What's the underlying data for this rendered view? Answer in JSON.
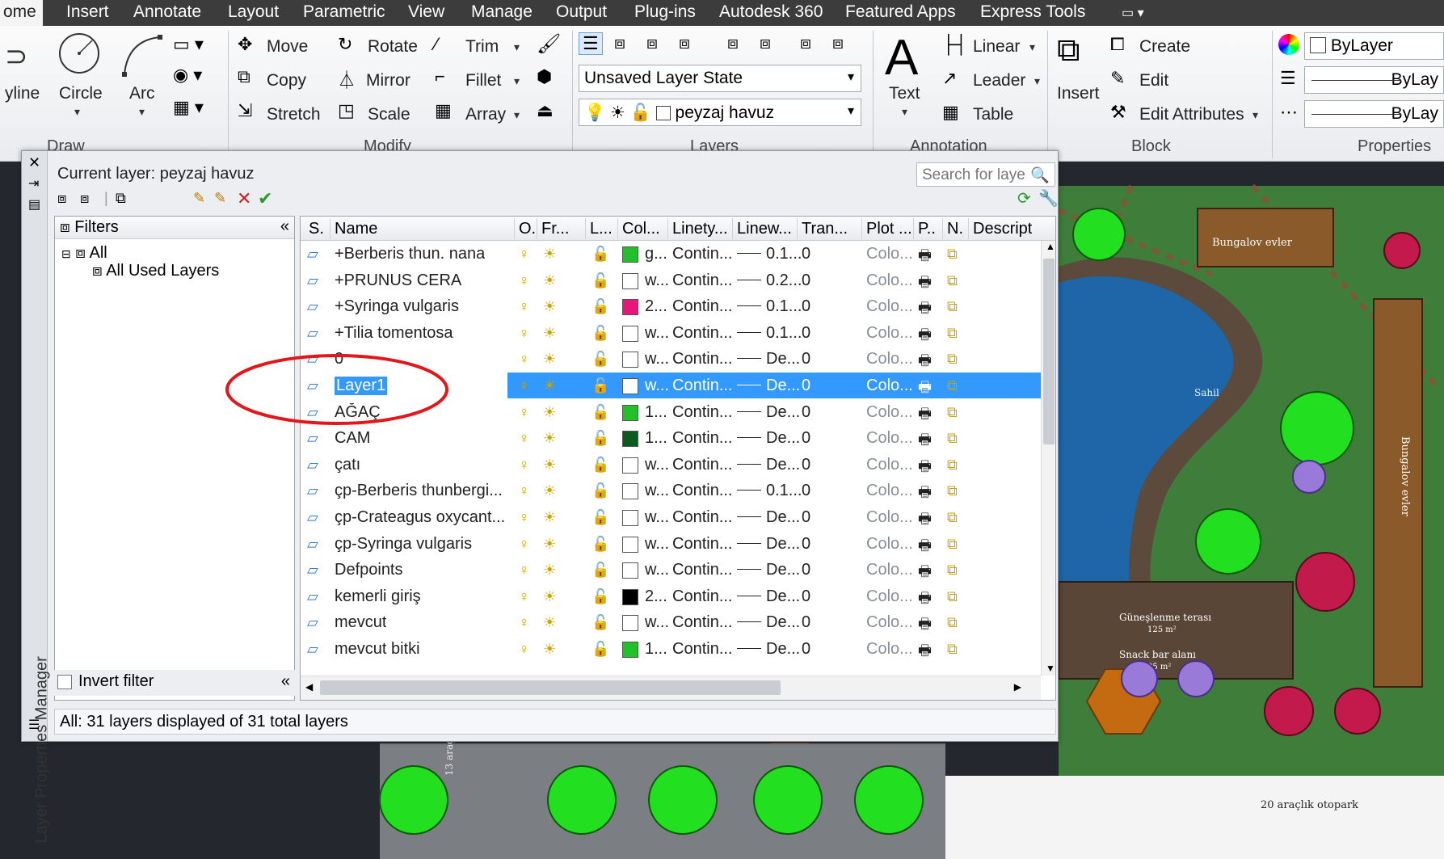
{
  "menu": [
    "ome",
    "Insert",
    "Annotate",
    "Layout",
    "Parametric",
    "View",
    "Manage",
    "Output",
    "Plug-ins",
    "Autodesk 360",
    "Featured Apps",
    "Express Tools"
  ],
  "ribbon": {
    "draw": {
      "title": "Draw",
      "polyline": "yline",
      "circle": "Circle",
      "arc": "Arc"
    },
    "modify": {
      "title": "Modify",
      "move": "Move",
      "rotate": "Rotate",
      "trim": "Trim",
      "copy": "Copy",
      "mirror": "Mirror",
      "fillet": "Fillet",
      "stretch": "Stretch",
      "scale": "Scale",
      "array": "Array"
    },
    "layers": {
      "title": "Layers",
      "state": "Unsaved Layer State",
      "current": "peyzaj havuz"
    },
    "annotation": {
      "title": "Annotation",
      "text": "Text",
      "linear": "Linear",
      "leader": "Leader",
      "table": "Table"
    },
    "block": {
      "title": "Block",
      "insert": "Insert",
      "create": "Create",
      "edit": "Edit",
      "edit_attributes": "Edit Attributes"
    },
    "properties": {
      "title": "Properties",
      "color": "ByLayer",
      "linetype": "ByLay",
      "lineweight": "ByLay"
    }
  },
  "palette": {
    "side_title": "Layer Properties Manager",
    "current_layer": "Current layer: peyzaj havuz",
    "search_placeholder": "Search for laye",
    "filters_label": "Filters",
    "tree_all": "All",
    "tree_used": "All Used Layers",
    "invert_filter": "Invert filter",
    "status": "All: 31 layers displayed of 31 total layers",
    "columns": [
      "S.",
      "Name",
      "O.",
      "Fr...",
      "L...",
      "Col...",
      "Linety...",
      "Linew...",
      "Tran...",
      "Plot ...",
      "P..",
      "N.",
      "Descript"
    ],
    "rows": [
      {
        "name": "+Berberis thun. nana",
        "color": "#22c02a",
        "color_name": "g...",
        "linetype": "Contin...",
        "lineweight": "0.1...",
        "transparency": "0",
        "plot_style": "Colo...",
        "selected": false
      },
      {
        "name": "+PRUNUS CERA",
        "color": "#ffffff",
        "color_name": "w...",
        "linetype": "Contin...",
        "lineweight": "0.2...",
        "transparency": "0",
        "plot_style": "Colo...",
        "selected": false
      },
      {
        "name": "+Syringa vulgaris",
        "color": "#e8157a",
        "color_name": "2...",
        "linetype": "Contin...",
        "lineweight": "0.1...",
        "transparency": "0",
        "plot_style": "Colo...",
        "selected": false
      },
      {
        "name": "+Tilia tomentosa",
        "color": "#ffffff",
        "color_name": "w...",
        "linetype": "Contin...",
        "lineweight": "0.1...",
        "transparency": "0",
        "plot_style": "Colo...",
        "selected": false
      },
      {
        "name": "0",
        "color": "#ffffff",
        "color_name": "w...",
        "linetype": "Contin...",
        "lineweight": "De...",
        "transparency": "0",
        "plot_style": "Colo...",
        "selected": false
      },
      {
        "name": "Layer1",
        "color": "#ffffff",
        "color_name": "w...",
        "linetype": "Contin...",
        "lineweight": "De...",
        "transparency": "0",
        "plot_style": "Colo...",
        "selected": true
      },
      {
        "name": "AĞAÇ",
        "color": "#22c02a",
        "color_name": "1...",
        "linetype": "Contin...",
        "lineweight": "De...",
        "transparency": "0",
        "plot_style": "Colo...",
        "selected": false
      },
      {
        "name": "CAM",
        "color": "#0b5a1e",
        "color_name": "1...",
        "linetype": "Contin...",
        "lineweight": "De...",
        "transparency": "0",
        "plot_style": "Colo...",
        "selected": false
      },
      {
        "name": "çatı",
        "color": "#ffffff",
        "color_name": "w...",
        "linetype": "Contin...",
        "lineweight": "De...",
        "transparency": "0",
        "plot_style": "Colo...",
        "selected": false
      },
      {
        "name": "çp-Berberis thunbergi...",
        "color": "#ffffff",
        "color_name": "w...",
        "linetype": "Contin...",
        "lineweight": "0.1...",
        "transparency": "0",
        "plot_style": "Colo...",
        "selected": false
      },
      {
        "name": "çp-Crateagus oxycant...",
        "color": "#ffffff",
        "color_name": "w...",
        "linetype": "Contin...",
        "lineweight": "De...",
        "transparency": "0",
        "plot_style": "Colo...",
        "selected": false
      },
      {
        "name": "çp-Syringa vulgaris",
        "color": "#ffffff",
        "color_name": "w...",
        "linetype": "Contin...",
        "lineweight": "De...",
        "transparency": "0",
        "plot_style": "Colo...",
        "selected": false
      },
      {
        "name": "Defpoints",
        "color": "#ffffff",
        "color_name": "w...",
        "linetype": "Contin...",
        "lineweight": "De...",
        "transparency": "0",
        "plot_style": "Colo...",
        "selected": false
      },
      {
        "name": "kemerli giriş",
        "color": "#000000",
        "color_name": "2...",
        "linetype": "Contin...",
        "lineweight": "De...",
        "transparency": "0",
        "plot_style": "Colo...",
        "selected": false
      },
      {
        "name": "mevcut",
        "color": "#ffffff",
        "color_name": "w...",
        "linetype": "Contin...",
        "lineweight": "De...",
        "transparency": "0",
        "plot_style": "Colo...",
        "selected": false
      },
      {
        "name": "mevcut bitki",
        "color": "#22c02a",
        "color_name": "1...",
        "linetype": "Contin...",
        "lineweight": "De...",
        "transparency": "0",
        "plot_style": "Colo...",
        "selected": false
      }
    ]
  },
  "drawing_labels": {
    "bungalow_top": "Bungalov evler",
    "bungalow_side": "Bungalov evler",
    "pool": "Sahil",
    "terrace": "Güneşlenme terası",
    "terrace_area": "125 m²",
    "snack": "Snack bar alanı",
    "snack_area": "95 m²",
    "parking": "20 araçlık otopark",
    "entry": "13 araç"
  },
  "colors": {
    "highlight": "#3399ff",
    "annotation_circle": "#e3161b",
    "lawn": "#3f7d3a",
    "pool": "#1e66a8"
  }
}
